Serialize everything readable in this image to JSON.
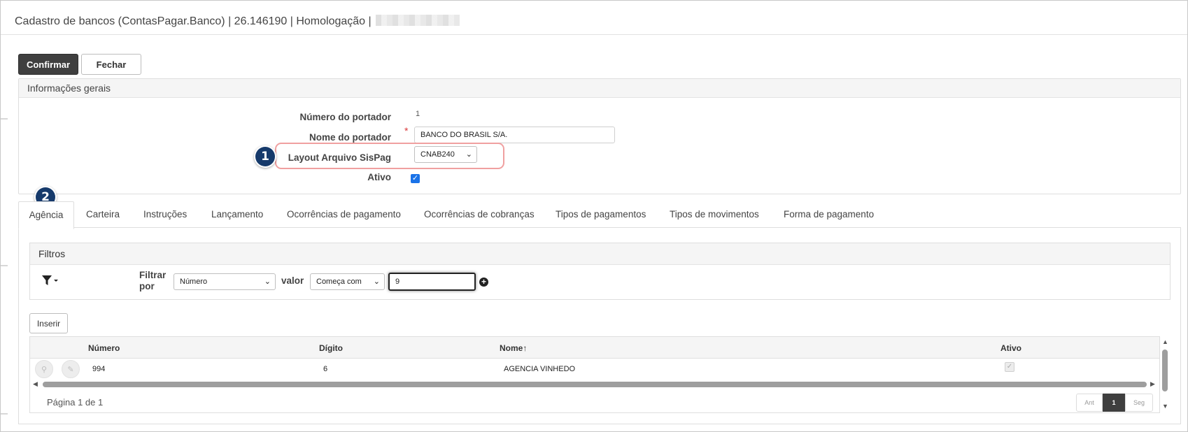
{
  "window": {
    "title": "Cadastro de bancos (ContasPagar.Banco) | 26.146190 | Homologação |"
  },
  "toolbar": {
    "confirm_label": "Confirmar",
    "close_label": "Fechar"
  },
  "general_info": {
    "header": "Informações gerais",
    "numero_portador_label": "Número do portador",
    "numero_portador_value": "1",
    "nome_portador_label": "Nome do portador",
    "nome_portador_value": "BANCO DO BRASIL S/A.",
    "layout_label": "Layout Arquivo SisPag",
    "layout_value": "CNAB240",
    "ativo_label": "Ativo",
    "ativo_checked": true,
    "required_mark": "*"
  },
  "markers": {
    "m1": "1",
    "m2": "2"
  },
  "tabs": [
    {
      "label": "Agência",
      "active": true
    },
    {
      "label": "Carteira"
    },
    {
      "label": "Instruções"
    },
    {
      "label": "Lançamento"
    },
    {
      "label": "Ocorrências de pagamento"
    },
    {
      "label": "Ocorrências de cobranças"
    },
    {
      "label": "Tipos de pagamentos"
    },
    {
      "label": "Tipos de movimentos"
    },
    {
      "label": "Forma de pagamento"
    }
  ],
  "filters": {
    "header": "Filtros",
    "filter_by_label_1": "Filtrar",
    "filter_by_label_2": "por",
    "field_value": "Número",
    "valor_label": "valor",
    "operator_value": "Começa com",
    "search_value": "9"
  },
  "insert_label": "Inserir",
  "table": {
    "columns": [
      "Número",
      "Dígito",
      "Nome",
      "Ativo"
    ],
    "sort_indicator": "↑",
    "rows": [
      {
        "numero": "994",
        "digito": "6",
        "nome": "AGENCIA VINHEDO",
        "ativo": true
      }
    ]
  },
  "pager": {
    "text": "Página 1 de 1",
    "prev": "Ant",
    "current": "1",
    "next": "Seg"
  },
  "icons": {
    "filter": "filter-icon",
    "add": "plus-circle-icon",
    "view": "search-icon",
    "edit": "pencil-icon"
  },
  "colors": {
    "primary_button": "#3f3f3f",
    "marker": "#163a6b",
    "highlight": "#f0a0a0",
    "checkbox": "#1a73e8"
  }
}
